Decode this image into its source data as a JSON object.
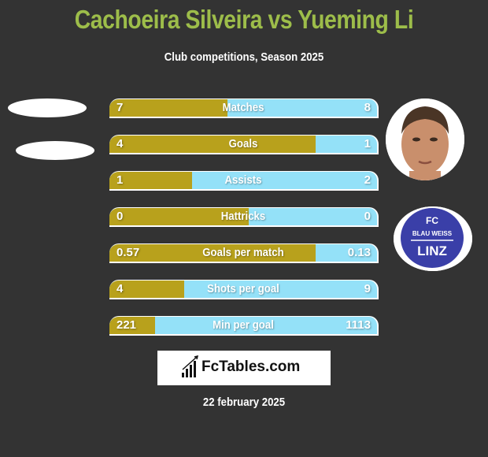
{
  "header": {
    "title": "Cachoeira Silveira vs Yueming Li",
    "subtitle": "Club competitions, Season 2025"
  },
  "colors": {
    "title": "#9dbd4a",
    "left_fill": "#b8a11c",
    "right_fill": "#94e1f8",
    "background": "#333333"
  },
  "stats": [
    {
      "label": "Matches",
      "left": "7",
      "right": "8",
      "left_share": 0.44
    },
    {
      "label": "Goals",
      "left": "4",
      "right": "1",
      "left_share": 0.77
    },
    {
      "label": "Assists",
      "left": "1",
      "right": "2",
      "left_share": 0.31
    },
    {
      "label": "Hattricks",
      "left": "0",
      "right": "0",
      "left_share": 0.52
    },
    {
      "label": "Goals per match",
      "left": "0.57",
      "right": "0.13",
      "left_share": 0.77
    },
    {
      "label": "Shots per goal",
      "left": "4",
      "right": "9",
      "left_share": 0.28
    },
    {
      "label": "Min per goal",
      "left": "221",
      "right": "1113",
      "left_share": 0.17
    }
  ],
  "right_player": {
    "name": "Yueming Li"
  },
  "right_club": {
    "line1": "FC",
    "line2": "BLAU WEISS",
    "line3": "LINZ"
  },
  "brand": {
    "name": "FcTables.com"
  },
  "footer": {
    "date": "22 february 2025"
  }
}
